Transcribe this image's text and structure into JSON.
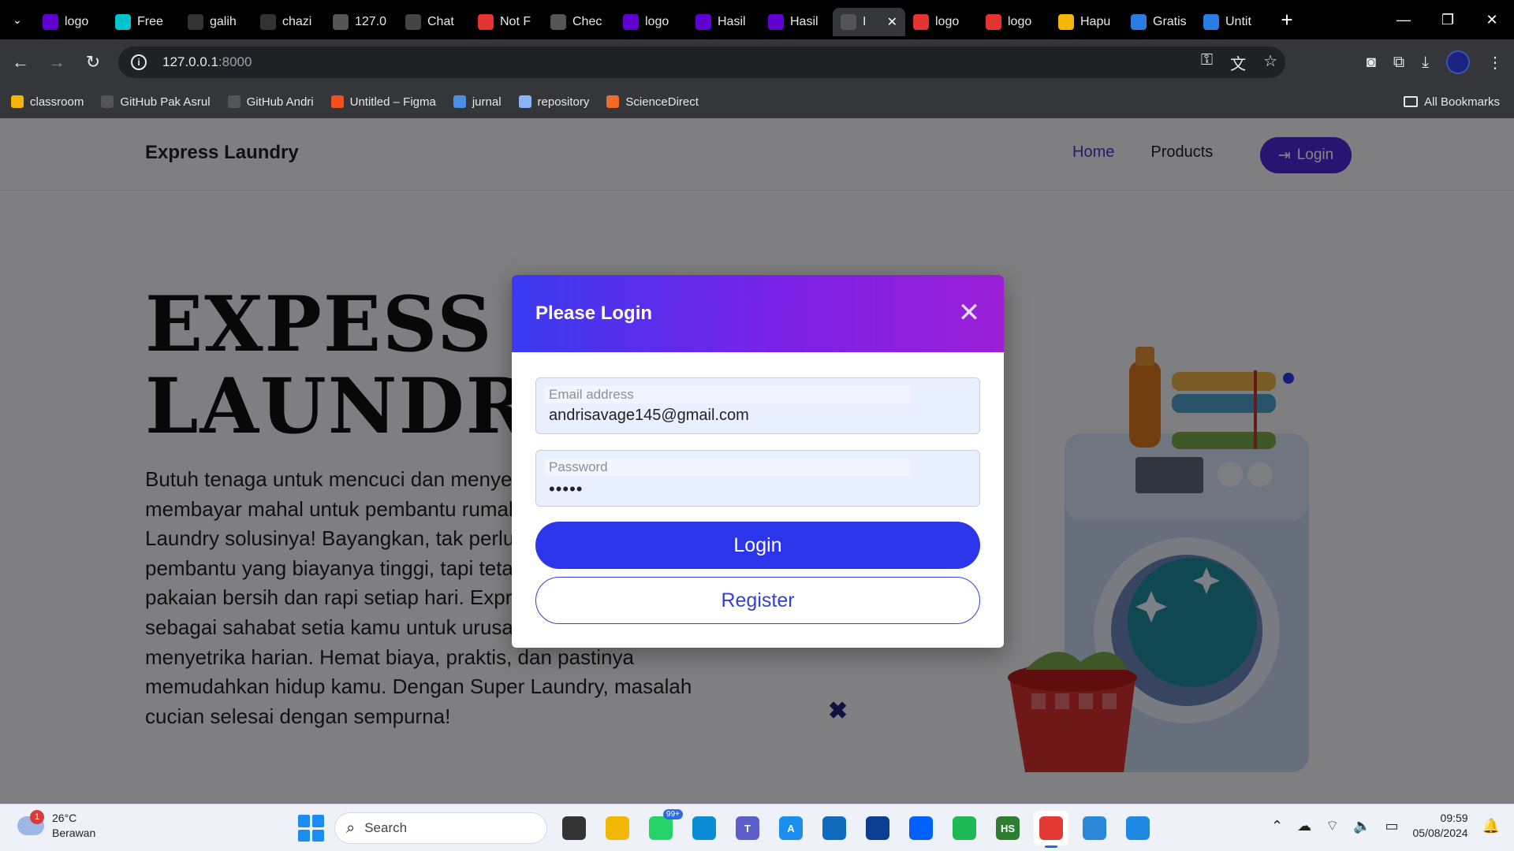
{
  "browser": {
    "tabs": [
      {
        "title": "logo",
        "icon": "yahoo-icon",
        "color": "#6001d2"
      },
      {
        "title": "Free",
        "icon": "canva-icon",
        "color": "#00c4cc"
      },
      {
        "title": "galih",
        "icon": "github-icon",
        "color": "#333333"
      },
      {
        "title": "chazi",
        "icon": "github-icon",
        "color": "#333333"
      },
      {
        "title": "127.0",
        "icon": "globe-icon",
        "color": "#555555"
      },
      {
        "title": "Chat",
        "icon": "openai-icon",
        "color": "#444444"
      },
      {
        "title": "Not F",
        "icon": "laravel-icon",
        "color": "#e3342f"
      },
      {
        "title": "Chec",
        "icon": "globe-icon",
        "color": "#555555"
      },
      {
        "title": "logo",
        "icon": "yahoo-icon",
        "color": "#6001d2"
      },
      {
        "title": "Hasil",
        "icon": "yahoo-icon",
        "color": "#6001d2"
      },
      {
        "title": "Hasil",
        "icon": "yahoo-icon",
        "color": "#6001d2"
      },
      {
        "title": "I",
        "icon": "globe-icon",
        "color": "#555555"
      },
      {
        "title": "logo",
        "icon": "laravel-icon",
        "color": "#e3342f"
      },
      {
        "title": "logo",
        "icon": "laravel-icon",
        "color": "#e3342f"
      },
      {
        "title": "Hapu",
        "icon": "book-icon",
        "color": "#f2b705"
      },
      {
        "title": "Gratis",
        "icon": "canva-icon",
        "color": "#2a7de1"
      },
      {
        "title": "Untit",
        "icon": "canva-icon",
        "color": "#2a7de1"
      }
    ],
    "active_tab_index": 11,
    "url_host": "127.0.0.1",
    "url_port": ":8000",
    "bookmarks": [
      {
        "label": "classroom",
        "icon": "classroom-icon",
        "color": "#f4b400"
      },
      {
        "label": "GitHub Pak Asrul",
        "icon": "github-icon",
        "color": "#555555"
      },
      {
        "label": "GitHub Andri",
        "icon": "github-icon",
        "color": "#555555"
      },
      {
        "label": "Untitled – Figma",
        "icon": "figma-icon",
        "color": "#f24e1e"
      },
      {
        "label": "jurnal",
        "icon": "jurnal-icon",
        "color": "#4a90e2"
      },
      {
        "label": "repository",
        "icon": "file-icon",
        "color": "#8ab4f8"
      },
      {
        "label": "ScienceDirect",
        "icon": "elsevier-icon",
        "color": "#f06a28"
      }
    ],
    "all_bookmarks_label": "All Bookmarks"
  },
  "site": {
    "brand": "Express Laundry",
    "nav": {
      "home": "Home",
      "products": "Products",
      "login": "Login"
    },
    "hero_title_line1": "EXPESS",
    "hero_title_line2": "LAUNDRY",
    "hero_text_lines": [
      "Butuh tenaga untuk mencuci dan menyetrika, tapi tak ingin",
      "membayar mahal untuk pembantu rumah tangga? Super",
      "Laundry solusinya! Bayangkan, tak perlu lagi merekrut",
      "pembantu yang biayanya tinggi, tapi tetap bisa mendapatkan",
      "pakaian bersih dan rapi setiap hari. Express Laundry hadir",
      "sebagai sahabat setia kamu untuk urusan mencuci dan",
      "menyetrika harian. Hemat biaya, praktis, dan pastinya",
      "memudahkan hidup kamu. Dengan Super Laundry, masalah",
      "cucian selesai dengan sempurna!"
    ]
  },
  "modal": {
    "title": "Please Login",
    "email": {
      "label": "Email address",
      "value": "andrisavage145@gmail.com"
    },
    "password": {
      "label": "Password",
      "value": "•••••"
    },
    "login_button": "Login",
    "register_button": "Register",
    "header_gradient": [
      "#3a3af0",
      "#9b1fd6"
    ]
  },
  "taskbar": {
    "weather_temp": "26°C",
    "weather_desc": "Berawan",
    "weather_badge": "1",
    "search_placeholder": "Search",
    "apps": [
      {
        "name": "task-view",
        "label": "",
        "color": "#333333"
      },
      {
        "name": "file-explorer",
        "label": "",
        "color": "#f2b705"
      },
      {
        "name": "whatsapp",
        "label": "",
        "color": "#25d366",
        "badge": "99+"
      },
      {
        "name": "edge",
        "label": "",
        "color": "#0c8bd6"
      },
      {
        "name": "teams",
        "label": "T",
        "color": "#5b5fc7"
      },
      {
        "name": "app-store-a",
        "label": "A",
        "color": "#1b8ef0"
      },
      {
        "name": "microsoft-store",
        "label": "",
        "color": "#0f6cbd"
      },
      {
        "name": "reader-app",
        "label": "",
        "color": "#0b3d91"
      },
      {
        "name": "dropbox",
        "label": "",
        "color": "#0061fe"
      },
      {
        "name": "spotify",
        "label": "",
        "color": "#1db954"
      },
      {
        "name": "hs-app",
        "label": "HS",
        "color": "#2e7d32"
      },
      {
        "name": "chrome",
        "label": "",
        "color": "#e53935"
      },
      {
        "name": "photos",
        "label": "",
        "color": "#2b88d8"
      },
      {
        "name": "vscode",
        "label": "",
        "color": "#1e88e5"
      }
    ],
    "time": "09:59",
    "date": "05/08/2024"
  }
}
